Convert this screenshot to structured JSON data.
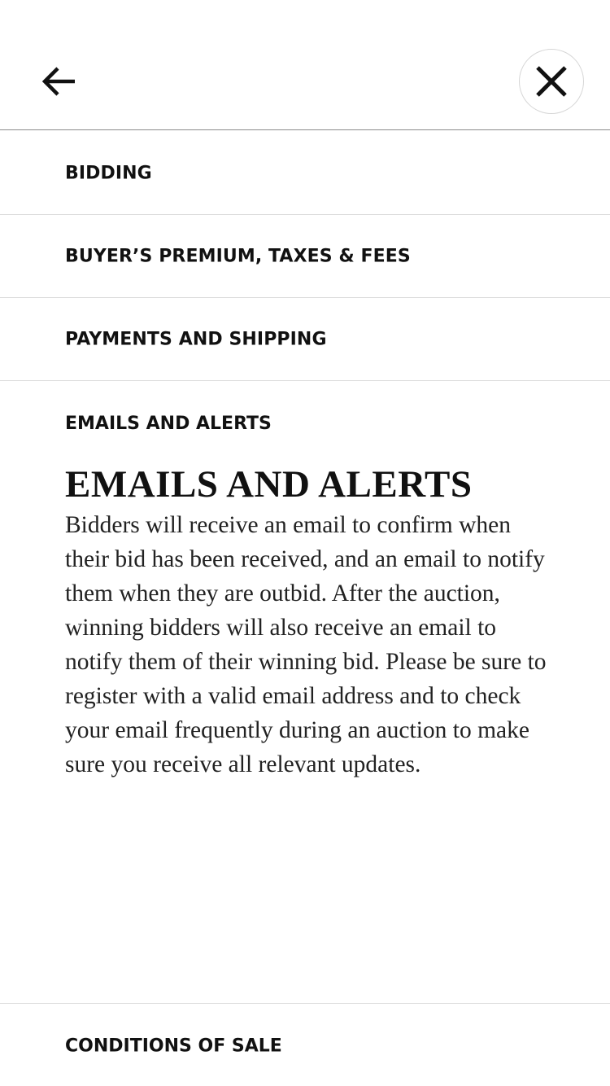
{
  "header": {
    "back_icon": "arrow-left-icon",
    "close_icon": "close-icon"
  },
  "menu": {
    "items": [
      {
        "label": "BIDDING"
      },
      {
        "label": "BUYER’S PREMIUM, TAXES & FEES"
      },
      {
        "label": "PAYMENTS AND SHIPPING"
      }
    ]
  },
  "expanded_section": {
    "label": "EMAILS AND ALERTS",
    "title": "EMAILS AND ALERTS",
    "body": "Bidders will receive an email to confirm when their bid has been received, and an email to notify them when they are outbid. After the auction, winning bidders will also receive an email to notify them of their winning bid. Please be sure to register with a valid email address and to check your email frequently during an auction to make sure you receive all relevant updates."
  },
  "footer_item": {
    "label": "CONDITIONS OF SALE"
  },
  "colors": {
    "text": "#111111",
    "divider": "#dddddd",
    "header_divider": "#8a8a8a",
    "background": "#ffffff"
  }
}
